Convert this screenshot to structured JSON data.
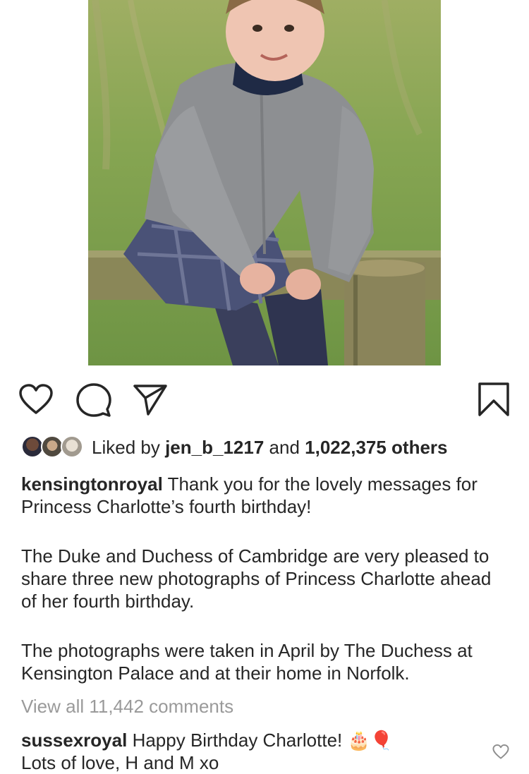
{
  "post": {
    "photo_alt": "Princess Charlotte",
    "likes": {
      "prefix": "Liked by",
      "user": "jen_b_1217",
      "joiner": "and",
      "others": "1,022,375 others"
    },
    "caption": {
      "username": "kensingtonroyal",
      "line1": "Thank you for the lovely messages for Princess Charlotte’s fourth birthday!",
      "para2": "The Duke and Duchess of Cambridge are very pleased to share three new photographs of Princess Charlotte ahead of her fourth birthday.",
      "para3": "The photographs were taken in April by The Duchess at Kensington Palace and at their home in Norfolk."
    },
    "view_all_comments": "View all 11,442 comments",
    "comment": {
      "username": "sussexroyal",
      "text": "Happy Birthday Charlotte! 🎂🎈",
      "line2": "Lots of love, H and M xo"
    }
  },
  "icons": {
    "like": "heart-icon",
    "comment": "comment-bubble-icon",
    "share": "paper-plane-icon",
    "save": "bookmark-icon",
    "comment_like": "heart-icon"
  },
  "colors": {
    "text": "#262626",
    "muted": "#9a9a9a",
    "background": "#ffffff"
  }
}
